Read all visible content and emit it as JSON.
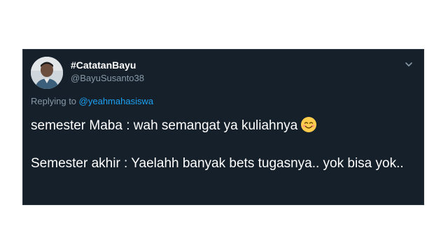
{
  "tweet": {
    "display_name": "#CatatanBayu",
    "handle": "@BayuSusanto38",
    "replying_to_label": "Replying to",
    "replying_to_handle": "@yeahmahasiswa",
    "line1": "semester Maba : wah semangat ya kuliahnya",
    "line1_emoji": "smiling-face-with-smiling-eyes-emoji",
    "line2": "Semester akhir : Yaelahh banyak bets tugasnya.. yok bisa yok..",
    "menu_icon": "chevron-down-icon"
  },
  "colors": {
    "card_bg": "#15202b",
    "text_primary": "#ffffff",
    "text_secondary": "#8899a6",
    "link": "#1da1f2"
  }
}
